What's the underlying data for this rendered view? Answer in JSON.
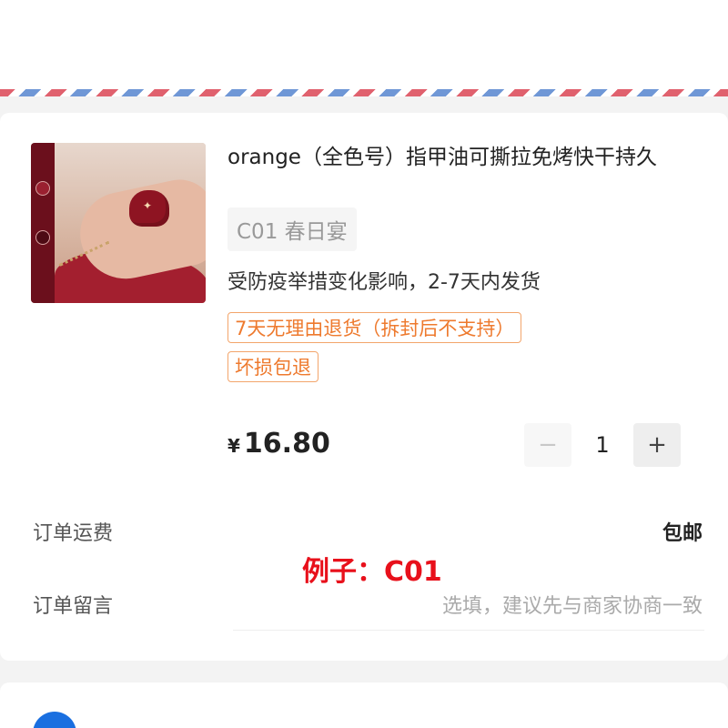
{
  "product": {
    "title": "orange（全色号）指甲油可撕拉免烤快干持久",
    "variant": "C01 春日宴",
    "shipping_note": "受防疫举措变化影响，2-7天内发货",
    "tags": [
      "7天无理由退货（拆封后不支持）",
      "坏损包退"
    ],
    "price": {
      "currency": "¥",
      "amount": "16.80"
    },
    "quantity": "1",
    "minus_symbol": "−",
    "plus_symbol": "+"
  },
  "order": {
    "shipping_label": "订单运费",
    "shipping_value": "包邮",
    "message_label": "订单留言",
    "message_placeholder": "选填，建议先与商家协商一致"
  },
  "overlay_text": "例子：C01",
  "colors": {
    "tag_orange": "#ee7a2e",
    "overlay_red": "#e8101b",
    "airmail_red": "#e0616e",
    "airmail_blue": "#6f97d6"
  }
}
